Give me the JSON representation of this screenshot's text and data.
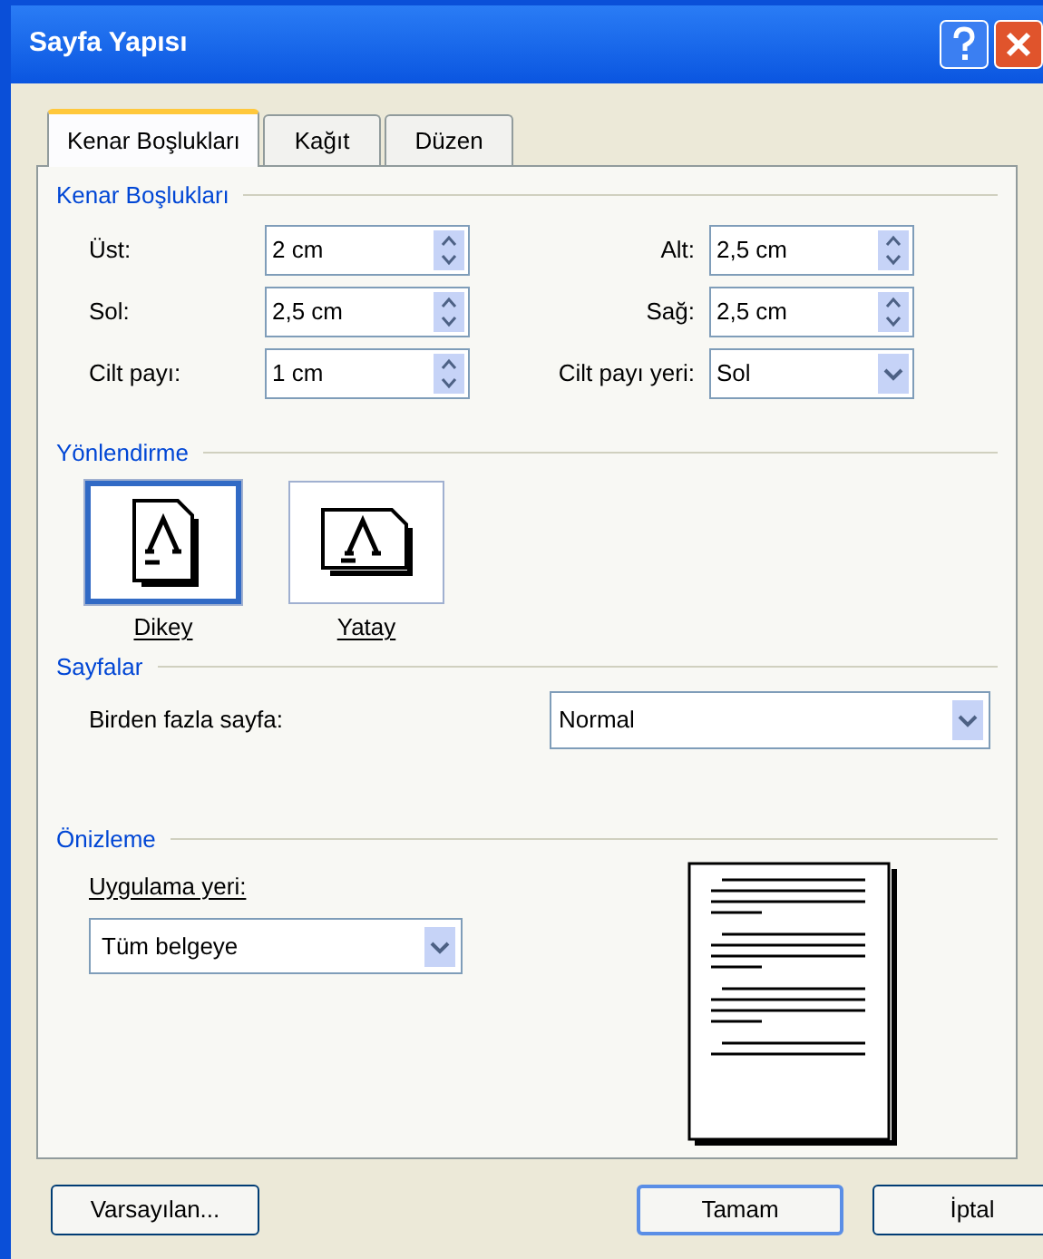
{
  "window": {
    "title": "Sayfa Yapısı"
  },
  "tabs": [
    {
      "label": "Kenar Boşlukları",
      "selected": true
    },
    {
      "label": "Kağıt",
      "selected": false
    },
    {
      "label": "Düzen",
      "selected": false
    }
  ],
  "margins": {
    "title": "Kenar Boşlukları",
    "fields": [
      {
        "label": "Üst:",
        "value": "2 cm",
        "kind": "spin"
      },
      {
        "label": "Alt:",
        "value": "2,5 cm",
        "kind": "spin"
      },
      {
        "label": "Sol:",
        "value": "2,5 cm",
        "kind": "spin"
      },
      {
        "label": "Sağ:",
        "value": "2,5 cm",
        "kind": "spin"
      },
      {
        "label": "Cilt payı:",
        "value": "1 cm",
        "kind": "spin"
      },
      {
        "label": "Cilt payı yeri:",
        "value": "Sol",
        "kind": "dropdown"
      }
    ]
  },
  "orientation": {
    "title": "Yönlendirme",
    "options": [
      {
        "label": "Dikey",
        "kind": "portrait",
        "selected": true
      },
      {
        "label": "Yatay",
        "kind": "landscape",
        "selected": false
      }
    ]
  },
  "pages": {
    "title": "Sayfalar",
    "label": "Birden fazla sayfa:",
    "value": "Normal"
  },
  "preview": {
    "title": "Önizleme",
    "apply_label": "Uygulama yeri:",
    "apply_value": "Tüm belgeye"
  },
  "buttons": [
    {
      "label": "Varsayılan...",
      "kind": "left"
    },
    {
      "label": "Tamam",
      "kind": "default"
    },
    {
      "label": "İptal",
      "kind": "normal"
    }
  ]
}
